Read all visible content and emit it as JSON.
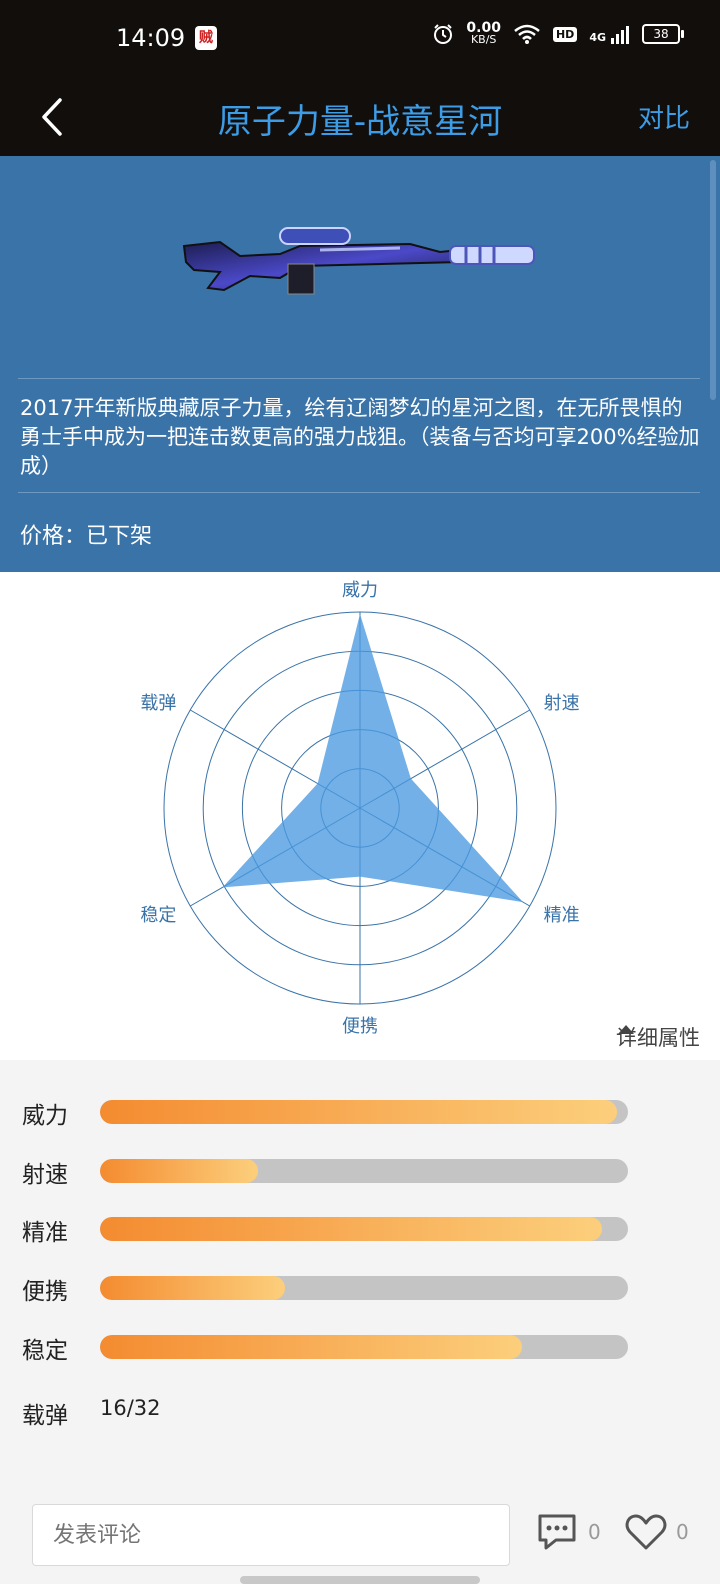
{
  "status_bar": {
    "time": "14:09",
    "app_badge": "贼",
    "net_speed_value": "0.00",
    "net_speed_unit": "KB/S",
    "hd": "HD",
    "network": "4G",
    "battery": "38"
  },
  "nav": {
    "title": "原子力量-战意星河",
    "compare_label": "对比"
  },
  "weapon": {
    "description": "2017开年新版典藏原子力量，绘有辽阔梦幻的星河之图，在无所畏惧的勇士手中成为一把连击数更高的强力战狙。（装备与否均可享200%经验加成）",
    "price_text": "价格：已下架"
  },
  "radar": {
    "labels": [
      "威力",
      "射速",
      "精准",
      "便携",
      "稳定",
      "载弹"
    ],
    "values": [
      0.99,
      0.3,
      0.96,
      0.35,
      0.81,
      0.25
    ],
    "fill_color": "#4a9ae0",
    "ring_color": "#3a73a8"
  },
  "detail_toggle_label": "详细属性",
  "stats": [
    {
      "label": "威力",
      "value": 0.98
    },
    {
      "label": "射速",
      "value": 0.3
    },
    {
      "label": "精准",
      "value": 0.95
    },
    {
      "label": "便携",
      "value": 0.35
    },
    {
      "label": "稳定",
      "value": 0.8
    }
  ],
  "ammo": {
    "label": "载弹",
    "value": "16/32"
  },
  "comments": {
    "placeholder": "发表评论",
    "comment_count": "0",
    "like_count": "0"
  },
  "colors": {
    "accent_blue": "#3c9ce6",
    "hero_bg": "#3a73a8",
    "bar_start": "#f48b30",
    "bar_end": "#fccf7c"
  }
}
